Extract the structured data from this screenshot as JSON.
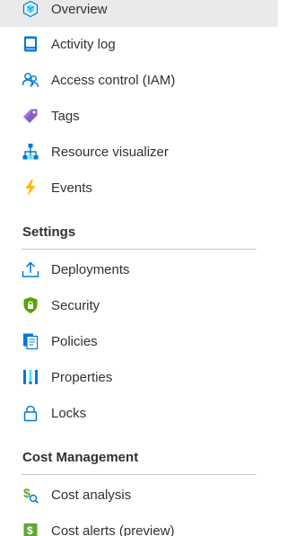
{
  "menu": {
    "top_items": [
      {
        "label": "Overview",
        "icon": "cube-icon"
      },
      {
        "label": "Activity log",
        "icon": "activity-log-icon"
      },
      {
        "label": "Access control (IAM)",
        "icon": "people-icon"
      },
      {
        "label": "Tags",
        "icon": "tag-icon"
      },
      {
        "label": "Resource visualizer",
        "icon": "hierarchy-icon"
      },
      {
        "label": "Events",
        "icon": "lightning-icon"
      }
    ],
    "settings": {
      "header": "Settings",
      "items": [
        {
          "label": "Deployments",
          "icon": "upload-icon"
        },
        {
          "label": "Security",
          "icon": "shield-lock-icon"
        },
        {
          "label": "Policies",
          "icon": "policy-document-icon"
        },
        {
          "label": "Properties",
          "icon": "properties-bars-icon"
        },
        {
          "label": "Locks",
          "icon": "lock-icon"
        }
      ]
    },
    "cost_management": {
      "header": "Cost Management",
      "items": [
        {
          "label": "Cost analysis",
          "icon": "cost-analysis-icon"
        },
        {
          "label": "Cost alerts (preview)",
          "icon": "cost-alerts-icon"
        }
      ]
    }
  },
  "colors": {
    "selected_bg": "#ebeaea",
    "text": "#323130",
    "divider": "#c8c6c4",
    "azure_blue": "#0078d4",
    "tag_purple": "#8661c5",
    "shield_green": "#57a300",
    "lightning_yellow": "#ffb900",
    "cost_green": "#5ea833"
  }
}
